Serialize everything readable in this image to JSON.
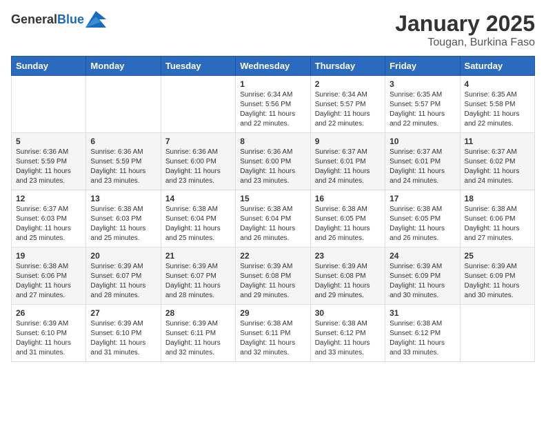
{
  "header": {
    "logo_general": "General",
    "logo_blue": "Blue",
    "title": "January 2025",
    "subtitle": "Tougan, Burkina Faso"
  },
  "days_of_week": [
    "Sunday",
    "Monday",
    "Tuesday",
    "Wednesday",
    "Thursday",
    "Friday",
    "Saturday"
  ],
  "weeks": [
    [
      {
        "day": "",
        "sunrise": "",
        "sunset": "",
        "daylight": ""
      },
      {
        "day": "",
        "sunrise": "",
        "sunset": "",
        "daylight": ""
      },
      {
        "day": "",
        "sunrise": "",
        "sunset": "",
        "daylight": ""
      },
      {
        "day": "1",
        "sunrise": "Sunrise: 6:34 AM",
        "sunset": "Sunset: 5:56 PM",
        "daylight": "Daylight: 11 hours and 22 minutes."
      },
      {
        "day": "2",
        "sunrise": "Sunrise: 6:34 AM",
        "sunset": "Sunset: 5:57 PM",
        "daylight": "Daylight: 11 hours and 22 minutes."
      },
      {
        "day": "3",
        "sunrise": "Sunrise: 6:35 AM",
        "sunset": "Sunset: 5:57 PM",
        "daylight": "Daylight: 11 hours and 22 minutes."
      },
      {
        "day": "4",
        "sunrise": "Sunrise: 6:35 AM",
        "sunset": "Sunset: 5:58 PM",
        "daylight": "Daylight: 11 hours and 22 minutes."
      }
    ],
    [
      {
        "day": "5",
        "sunrise": "Sunrise: 6:36 AM",
        "sunset": "Sunset: 5:59 PM",
        "daylight": "Daylight: 11 hours and 23 minutes."
      },
      {
        "day": "6",
        "sunrise": "Sunrise: 6:36 AM",
        "sunset": "Sunset: 5:59 PM",
        "daylight": "Daylight: 11 hours and 23 minutes."
      },
      {
        "day": "7",
        "sunrise": "Sunrise: 6:36 AM",
        "sunset": "Sunset: 6:00 PM",
        "daylight": "Daylight: 11 hours and 23 minutes."
      },
      {
        "day": "8",
        "sunrise": "Sunrise: 6:36 AM",
        "sunset": "Sunset: 6:00 PM",
        "daylight": "Daylight: 11 hours and 23 minutes."
      },
      {
        "day": "9",
        "sunrise": "Sunrise: 6:37 AM",
        "sunset": "Sunset: 6:01 PM",
        "daylight": "Daylight: 11 hours and 24 minutes."
      },
      {
        "day": "10",
        "sunrise": "Sunrise: 6:37 AM",
        "sunset": "Sunset: 6:01 PM",
        "daylight": "Daylight: 11 hours and 24 minutes."
      },
      {
        "day": "11",
        "sunrise": "Sunrise: 6:37 AM",
        "sunset": "Sunset: 6:02 PM",
        "daylight": "Daylight: 11 hours and 24 minutes."
      }
    ],
    [
      {
        "day": "12",
        "sunrise": "Sunrise: 6:37 AM",
        "sunset": "Sunset: 6:03 PM",
        "daylight": "Daylight: 11 hours and 25 minutes."
      },
      {
        "day": "13",
        "sunrise": "Sunrise: 6:38 AM",
        "sunset": "Sunset: 6:03 PM",
        "daylight": "Daylight: 11 hours and 25 minutes."
      },
      {
        "day": "14",
        "sunrise": "Sunrise: 6:38 AM",
        "sunset": "Sunset: 6:04 PM",
        "daylight": "Daylight: 11 hours and 25 minutes."
      },
      {
        "day": "15",
        "sunrise": "Sunrise: 6:38 AM",
        "sunset": "Sunset: 6:04 PM",
        "daylight": "Daylight: 11 hours and 26 minutes."
      },
      {
        "day": "16",
        "sunrise": "Sunrise: 6:38 AM",
        "sunset": "Sunset: 6:05 PM",
        "daylight": "Daylight: 11 hours and 26 minutes."
      },
      {
        "day": "17",
        "sunrise": "Sunrise: 6:38 AM",
        "sunset": "Sunset: 6:05 PM",
        "daylight": "Daylight: 11 hours and 26 minutes."
      },
      {
        "day": "18",
        "sunrise": "Sunrise: 6:38 AM",
        "sunset": "Sunset: 6:06 PM",
        "daylight": "Daylight: 11 hours and 27 minutes."
      }
    ],
    [
      {
        "day": "19",
        "sunrise": "Sunrise: 6:38 AM",
        "sunset": "Sunset: 6:06 PM",
        "daylight": "Daylight: 11 hours and 27 minutes."
      },
      {
        "day": "20",
        "sunrise": "Sunrise: 6:39 AM",
        "sunset": "Sunset: 6:07 PM",
        "daylight": "Daylight: 11 hours and 28 minutes."
      },
      {
        "day": "21",
        "sunrise": "Sunrise: 6:39 AM",
        "sunset": "Sunset: 6:07 PM",
        "daylight": "Daylight: 11 hours and 28 minutes."
      },
      {
        "day": "22",
        "sunrise": "Sunrise: 6:39 AM",
        "sunset": "Sunset: 6:08 PM",
        "daylight": "Daylight: 11 hours and 29 minutes."
      },
      {
        "day": "23",
        "sunrise": "Sunrise: 6:39 AM",
        "sunset": "Sunset: 6:08 PM",
        "daylight": "Daylight: 11 hours and 29 minutes."
      },
      {
        "day": "24",
        "sunrise": "Sunrise: 6:39 AM",
        "sunset": "Sunset: 6:09 PM",
        "daylight": "Daylight: 11 hours and 30 minutes."
      },
      {
        "day": "25",
        "sunrise": "Sunrise: 6:39 AM",
        "sunset": "Sunset: 6:09 PM",
        "daylight": "Daylight: 11 hours and 30 minutes."
      }
    ],
    [
      {
        "day": "26",
        "sunrise": "Sunrise: 6:39 AM",
        "sunset": "Sunset: 6:10 PM",
        "daylight": "Daylight: 11 hours and 31 minutes."
      },
      {
        "day": "27",
        "sunrise": "Sunrise: 6:39 AM",
        "sunset": "Sunset: 6:10 PM",
        "daylight": "Daylight: 11 hours and 31 minutes."
      },
      {
        "day": "28",
        "sunrise": "Sunrise: 6:39 AM",
        "sunset": "Sunset: 6:11 PM",
        "daylight": "Daylight: 11 hours and 32 minutes."
      },
      {
        "day": "29",
        "sunrise": "Sunrise: 6:38 AM",
        "sunset": "Sunset: 6:11 PM",
        "daylight": "Daylight: 11 hours and 32 minutes."
      },
      {
        "day": "30",
        "sunrise": "Sunrise: 6:38 AM",
        "sunset": "Sunset: 6:12 PM",
        "daylight": "Daylight: 11 hours and 33 minutes."
      },
      {
        "day": "31",
        "sunrise": "Sunrise: 6:38 AM",
        "sunset": "Sunset: 6:12 PM",
        "daylight": "Daylight: 11 hours and 33 minutes."
      },
      {
        "day": "",
        "sunrise": "",
        "sunset": "",
        "daylight": ""
      }
    ]
  ]
}
